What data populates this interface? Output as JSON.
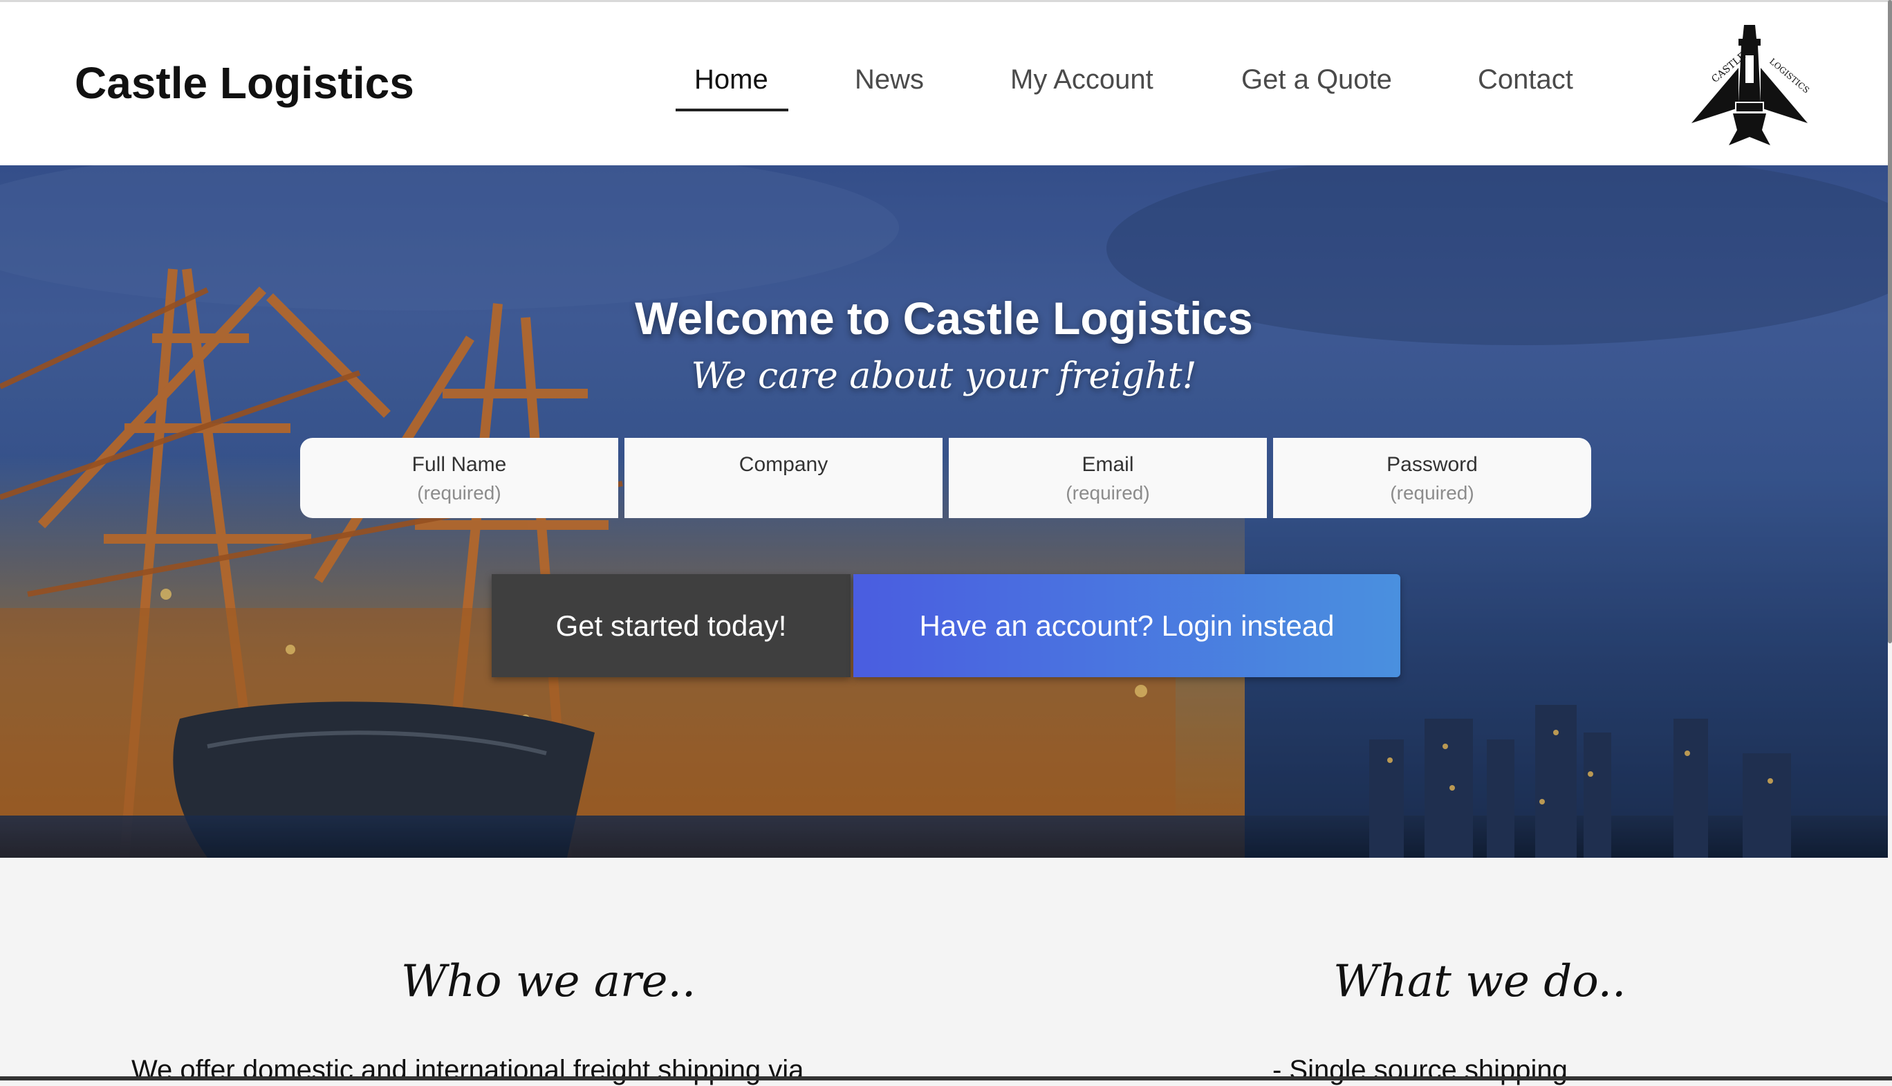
{
  "header": {
    "brand": "Castle Logistics",
    "nav": [
      "Home",
      "News",
      "My Account",
      "Get a Quote",
      "Contact"
    ],
    "active": "Home",
    "logo_text_left": "CASTLE",
    "logo_text_right": "LOGISTICS"
  },
  "hero": {
    "title": "Welcome to Castle Logistics",
    "subtitle": "We care about your freight!",
    "fields": [
      {
        "label": "Full Name",
        "placeholder": "(required)"
      },
      {
        "label": "Company",
        "placeholder": ""
      },
      {
        "label": "Email",
        "placeholder": "(required)"
      },
      {
        "label": "Password",
        "placeholder": "(required)"
      }
    ],
    "primary_button": "Get started today!",
    "secondary_button": "Have an account? Login instead"
  },
  "sections": {
    "who_title": "Who we are..",
    "who_text": "We offer domestic and international freight shipping via",
    "what_title": "What we do..",
    "what_text": "- Single source shipping"
  },
  "colors": {
    "login_gradient_start": "#4a5de0",
    "login_gradient_end": "#4a90df",
    "primary_button": "#3f3f3f"
  }
}
